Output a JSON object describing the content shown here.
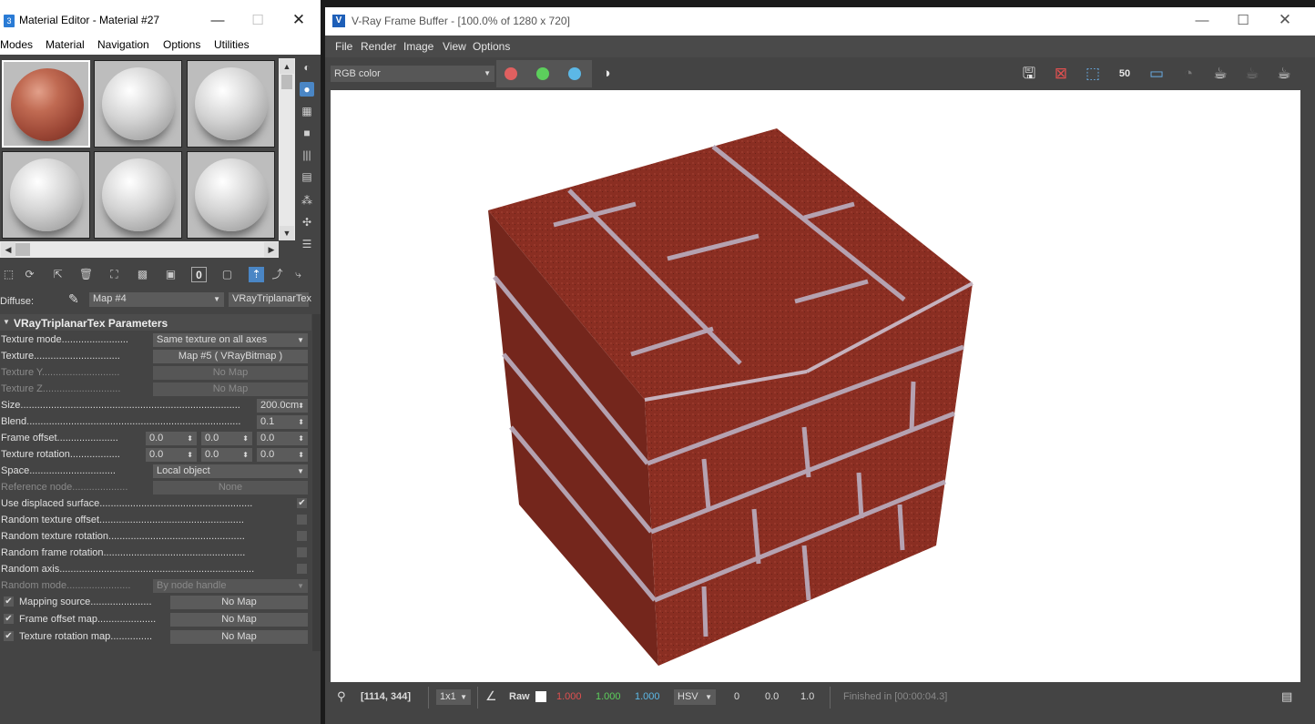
{
  "material_editor": {
    "title": "Material Editor - Material #27",
    "menu": [
      "Modes",
      "Material",
      "Navigation",
      "Options",
      "Utilities"
    ],
    "diffuse_label": "Diffuse:",
    "map_name": "Map #4",
    "map_type": "VRayTriplanarTex",
    "rollout_title": "VRayTriplanarTex Parameters",
    "params": {
      "texture_mode_label": "Texture mode........................",
      "texture_mode_value": "Same texture on all axes",
      "texture_label": "Texture...............................",
      "texture_value": "Map #5  ( VRayBitmap )",
      "texture_y_label": "Texture Y............................",
      "texture_y_value": "No Map",
      "texture_z_label": "Texture Z............................",
      "texture_z_value": "No Map",
      "size_label": "Size...............................................................................",
      "size_value": "200.0cm",
      "blend_label": "Blend.............................................................................",
      "blend_value": "0.1",
      "frame_offset_label": "Frame offset......................",
      "frame_offset_values": [
        "0.0",
        "0.0",
        "0.0"
      ],
      "texture_rotation_label": "Texture rotation..................",
      "texture_rotation_values": [
        "0.0",
        "0.0",
        "0.0"
      ],
      "space_label": "Space...............................",
      "space_value": "Local object",
      "reference_node_label": "Reference node....................",
      "reference_node_value": "None",
      "use_displaced_label": "Use displaced surface.......................................................",
      "random_tex_offset_label": "Random texture offset....................................................",
      "random_tex_rotation_label": "Random texture rotation.................................................",
      "random_frame_rotation_label": "Random frame rotation...................................................",
      "random_axis_label": "Random axis......................................................................",
      "random_mode_label": "Random mode.......................",
      "random_mode_value": "By node handle",
      "mapping_source_label": "Mapping source......................",
      "mapping_source_value": "No Map",
      "frame_offset_map_label": "Frame offset map.....................",
      "frame_offset_map_value": "No Map",
      "texture_rotation_map_label": "Texture rotation map...............",
      "texture_rotation_map_value": "No Map"
    },
    "toolbar_badge": "0"
  },
  "vfb": {
    "title": "V-Ray Frame Buffer - [100.0% of 1280 x 720]",
    "menu": [
      "File",
      "Render",
      "Image",
      "View",
      "Options"
    ],
    "channel": "RGB color",
    "zoom_badge": "50",
    "status": {
      "coords": "[1114, 344]",
      "ratio": "1x1",
      "raw": "Raw",
      "r": "1.000",
      "g": "1.000",
      "b": "1.000",
      "colorspace": "HSV",
      "h": "0",
      "s": "0.0",
      "v": "1.0",
      "message": "Finished in [00:00:04.3]"
    }
  },
  "colors": {
    "red_channel": "#e06060",
    "green_channel": "#5ccf5c",
    "blue_channel": "#5cb8e6",
    "accent": "#4a86c5",
    "brick": "#8a2e22",
    "mortar": "#b8a9b9"
  }
}
